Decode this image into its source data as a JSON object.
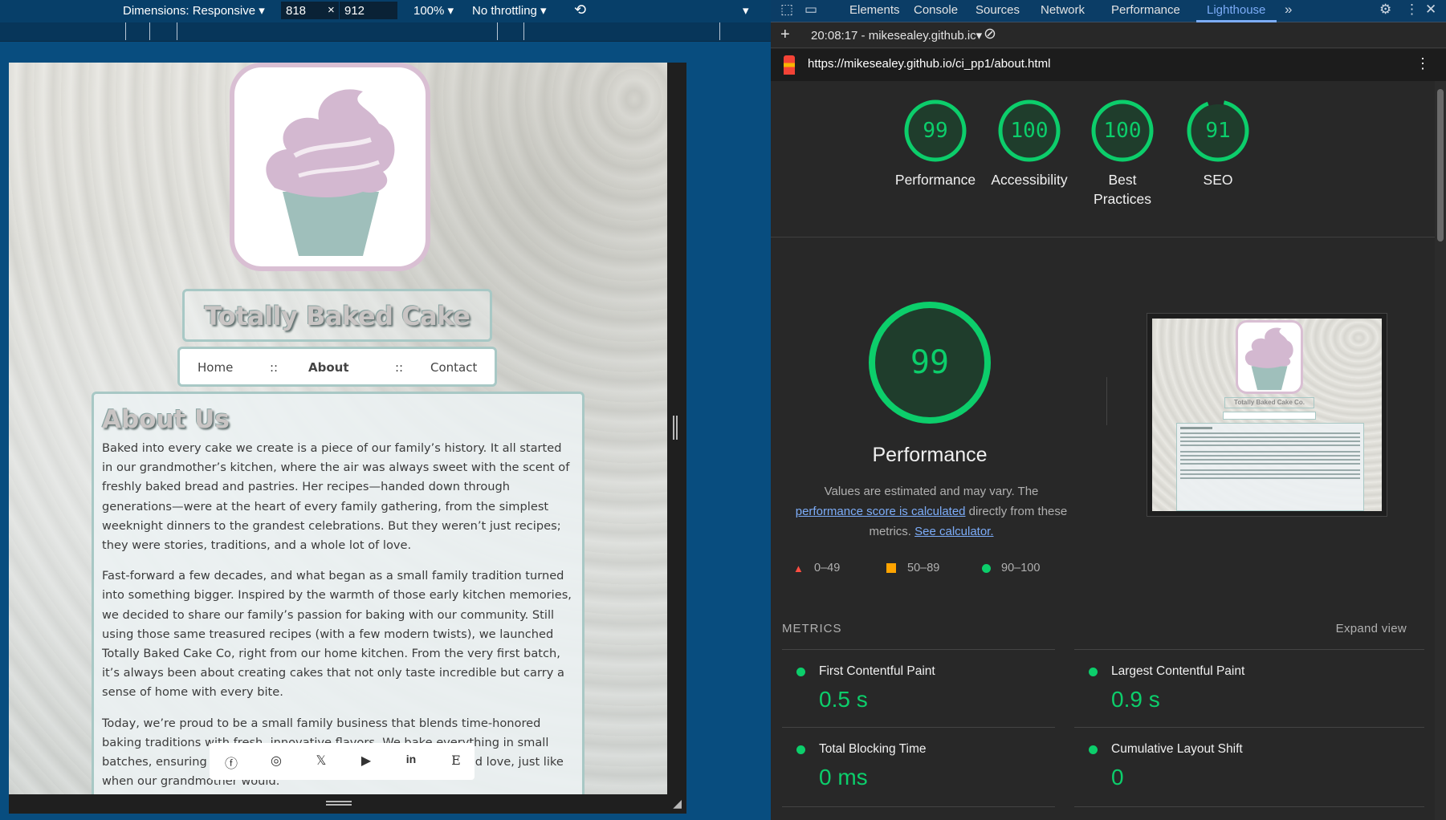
{
  "device_toolbar": {
    "dimensions_label": "Dimensions: Responsive",
    "width": "818",
    "times": "×",
    "height": "912",
    "zoom": "100%",
    "throttling": "No throttling"
  },
  "site": {
    "title": "Totally Baked Cake Co.",
    "nav": [
      "Home",
      "::",
      "About",
      "::",
      "Contact"
    ],
    "heading": "About Us",
    "paragraphs": [
      "Baked into every cake we create is a piece of our family’s history. It all started in our grandmother’s kitchen, where the air was always sweet with the scent of freshly baked bread and pastries. Her recipes—handed down through generations—were at the heart of every family gathering, from the simplest weeknight dinners to the grandest celebrations. But they weren’t just recipes; they were stories, traditions, and a whole lot of love.",
      "Fast-forward a few decades, and what began as a small family tradition turned into something bigger. Inspired by the warmth of those early kitchen memories, we decided to share our family’s passion for baking with our community. Still using those same treasured recipes (with a few modern twists), we launched Totally Baked Cake Co, right from our home kitchen. From the very first batch, it’s always been about creating cakes that not only taste incredible but carry a sense of home with every bite.",
      "Today, we’re proud to be a small family business that blends time-honored baking traditions with fresh, innovative flavors. We bake everything in small batches, ensuring each creation is made with the same care and love, just like when our grandmother would."
    ],
    "social": [
      "facebook-icon",
      "instagram-icon",
      "x-icon",
      "youtube-icon",
      "linkedin-icon",
      "etsy-icon"
    ],
    "social_glyphs": [
      "ⓕ",
      "◎",
      "𝕏",
      "▶",
      "in",
      "E"
    ]
  },
  "devtools": {
    "tabs": [
      "Elements",
      "Console",
      "Sources",
      "Network",
      "Performance",
      "Lighthouse"
    ],
    "active_tab": "Lighthouse",
    "report_label": "20:08:17 - mikesealey.github.ic▾",
    "url": "https://mikesealey.github.io/ci_pp1/about.html"
  },
  "scores": [
    {
      "value": 99,
      "label": "Performance"
    },
    {
      "value": 100,
      "label": "Accessibility"
    },
    {
      "value": 100,
      "label": "Best Practices"
    },
    {
      "value": 91,
      "label": "SEO"
    }
  ],
  "performance": {
    "score": "99",
    "title": "Performance",
    "desc_prefix": "Values are estimated and may vary. The ",
    "desc_link1": "performance score is calculated",
    "desc_mid": " directly from these metrics. ",
    "desc_link2": "See calculator.",
    "legend": [
      "0–49",
      "50–89",
      "90–100"
    ]
  },
  "metrics": {
    "header": "METRICS",
    "expand": "Expand view",
    "items": [
      {
        "name": "First Contentful Paint",
        "value": "0.5 s"
      },
      {
        "name": "Largest Contentful Paint",
        "value": "0.9 s"
      },
      {
        "name": "Total Blocking Time",
        "value": "0 ms"
      },
      {
        "name": "Cumulative Layout Shift",
        "value": "0"
      }
    ]
  },
  "colors": {
    "good": "#0cce6b",
    "average": "#ffa400",
    "poor": "#ff4e42",
    "link": "#7cacf8"
  }
}
